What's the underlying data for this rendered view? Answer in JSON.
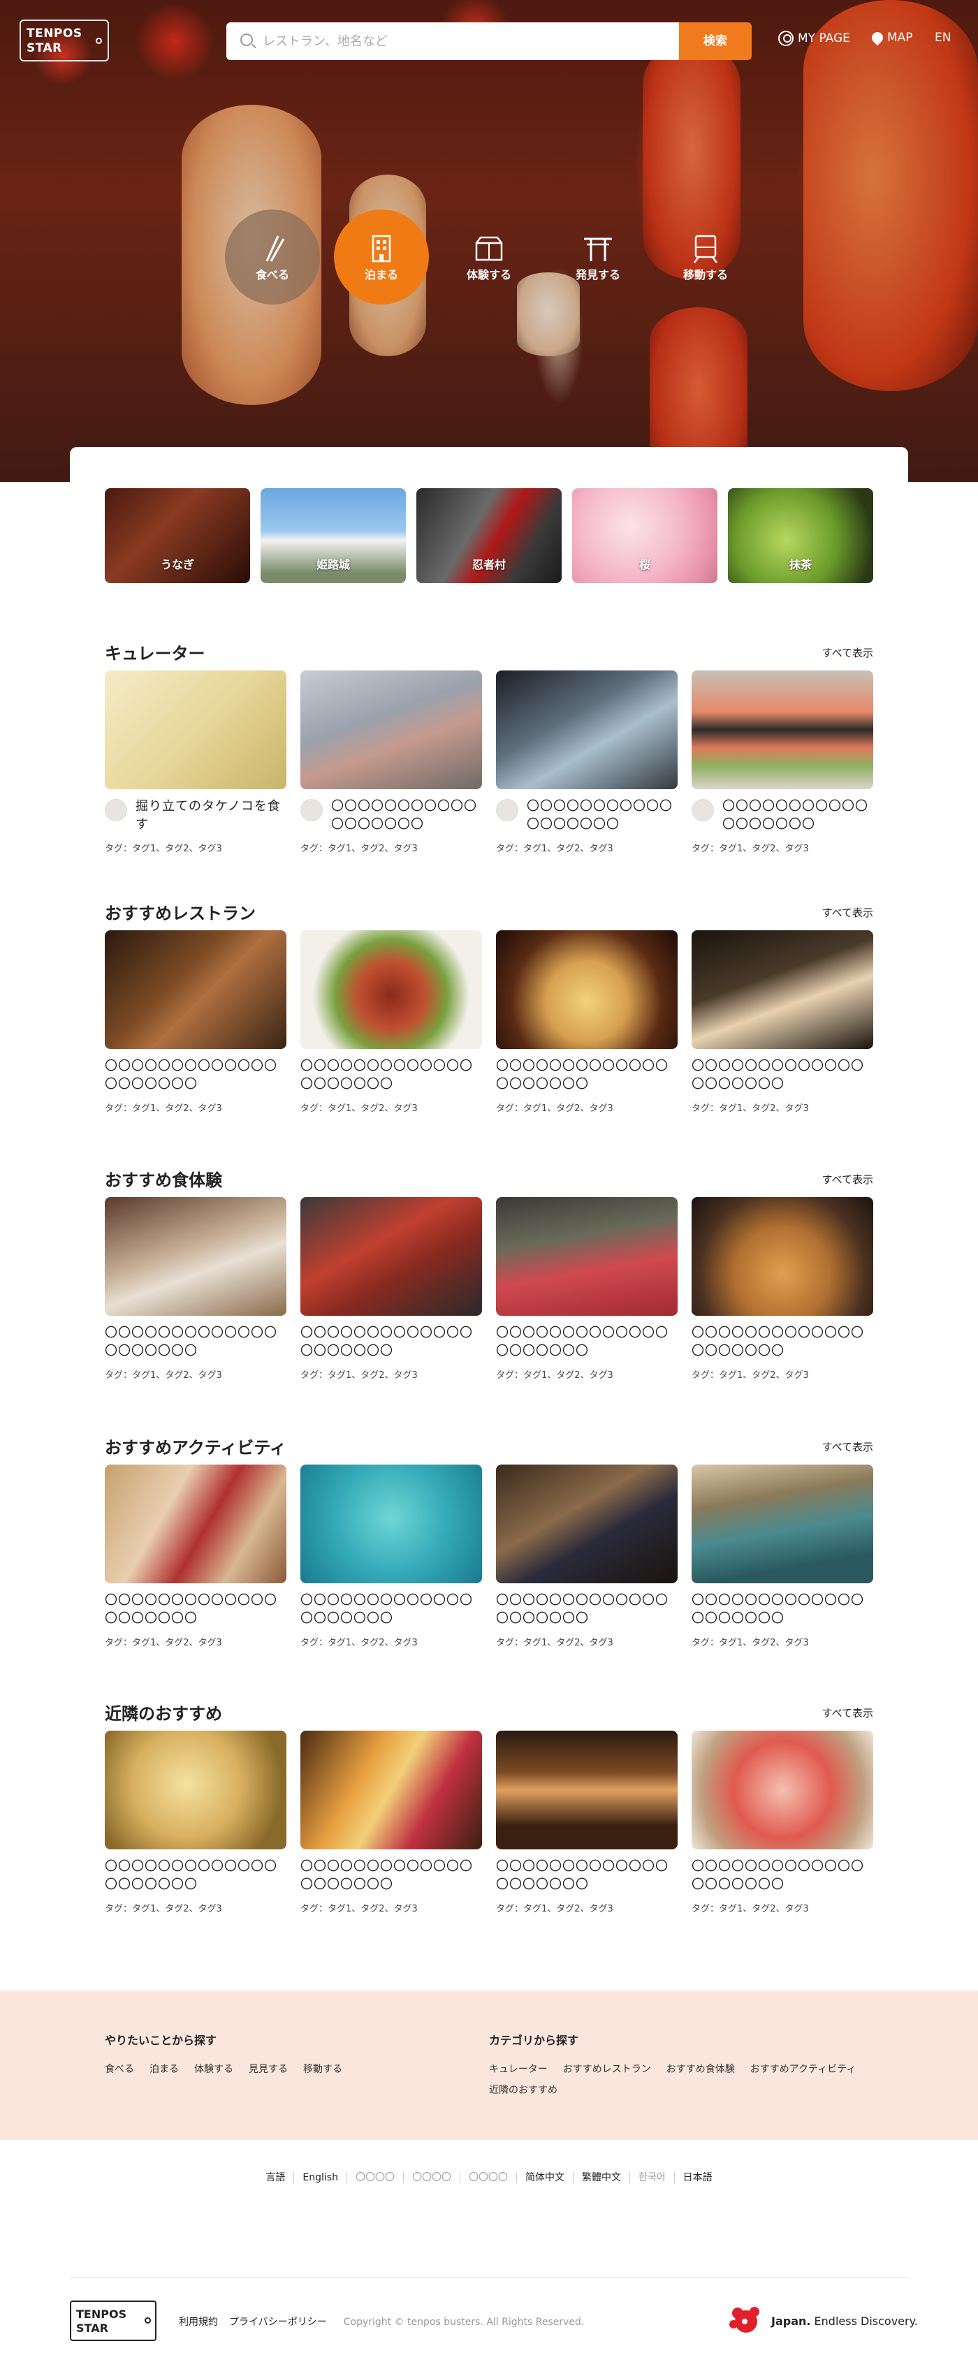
{
  "header": {
    "logo_line1": "TENPOS",
    "logo_line2": "STAR",
    "search_placeholder": "レストラン、地名など",
    "search_button": "検索",
    "mypage": "MY PAGE",
    "map": "MAP",
    "language": "EN"
  },
  "hero_categories": [
    {
      "label": "食べる",
      "icon": "chopsticks-icon",
      "active": false
    },
    {
      "label": "泊まる",
      "icon": "hotel-building-icon",
      "active": true
    },
    {
      "label": "体験する",
      "icon": "experience-box-icon",
      "active": false
    },
    {
      "label": "発見する",
      "icon": "torii-gate-icon",
      "active": false
    },
    {
      "label": "移動する",
      "icon": "train-icon",
      "active": false
    }
  ],
  "features": [
    {
      "label": "うなぎ"
    },
    {
      "label": "姫路城"
    },
    {
      "label": "忍者村"
    },
    {
      "label": "桜"
    },
    {
      "label": "抹茶"
    }
  ],
  "see_all": "すべて表示",
  "tag_line": "タグ：タグ1、タグ2、タグ3",
  "placeholder_title": "〇〇〇〇〇〇〇〇〇〇〇〇〇〇〇〇〇〇〇〇",
  "sections": [
    {
      "title": "キュレーター",
      "cards": [
        {
          "title": "掘り立てのタケノコを食す"
        },
        {
          "title": "〇〇〇〇〇〇〇〇〇〇〇〇〇〇〇〇〇〇"
        },
        {
          "title": "〇〇〇〇〇〇〇〇〇〇〇〇〇〇〇〇〇〇"
        },
        {
          "title": "〇〇〇〇〇〇〇〇〇〇〇〇〇〇〇〇〇〇"
        }
      ]
    },
    {
      "title": "おすすめレストラン"
    },
    {
      "title": "おすすめ食体験"
    },
    {
      "title": "おすすめアクティビティ"
    },
    {
      "title": "近隣のおすすめ"
    }
  ],
  "footer_nav": {
    "left_heading": "やりたいことから探す",
    "left_links": [
      "食べる",
      "泊まる",
      "体験する",
      "見見する",
      "移動する"
    ],
    "right_heading": "カテゴリから探す",
    "right_links": [
      "キュレーター",
      "おすすめレストラン",
      "おすすめ食体験",
      "おすすめアクティビティ",
      "近隣のおすすめ"
    ]
  },
  "languages": [
    "言語",
    "English",
    "〇〇〇〇",
    "〇〇〇〇",
    "〇〇〇〇",
    "简体中文",
    "繁體中文",
    "한국어",
    "日本語"
  ],
  "bottom": {
    "terms": "利用規約",
    "privacy": "プライバシーポリシー",
    "copyright": "Copyright © tenpos busters. All Rights Reserved.",
    "japan_bold": "Japan.",
    "japan_tagline": " Endless Discovery."
  },
  "colors": {
    "accent": "#f07a1e",
    "footer_bg": "#fae6dc"
  }
}
